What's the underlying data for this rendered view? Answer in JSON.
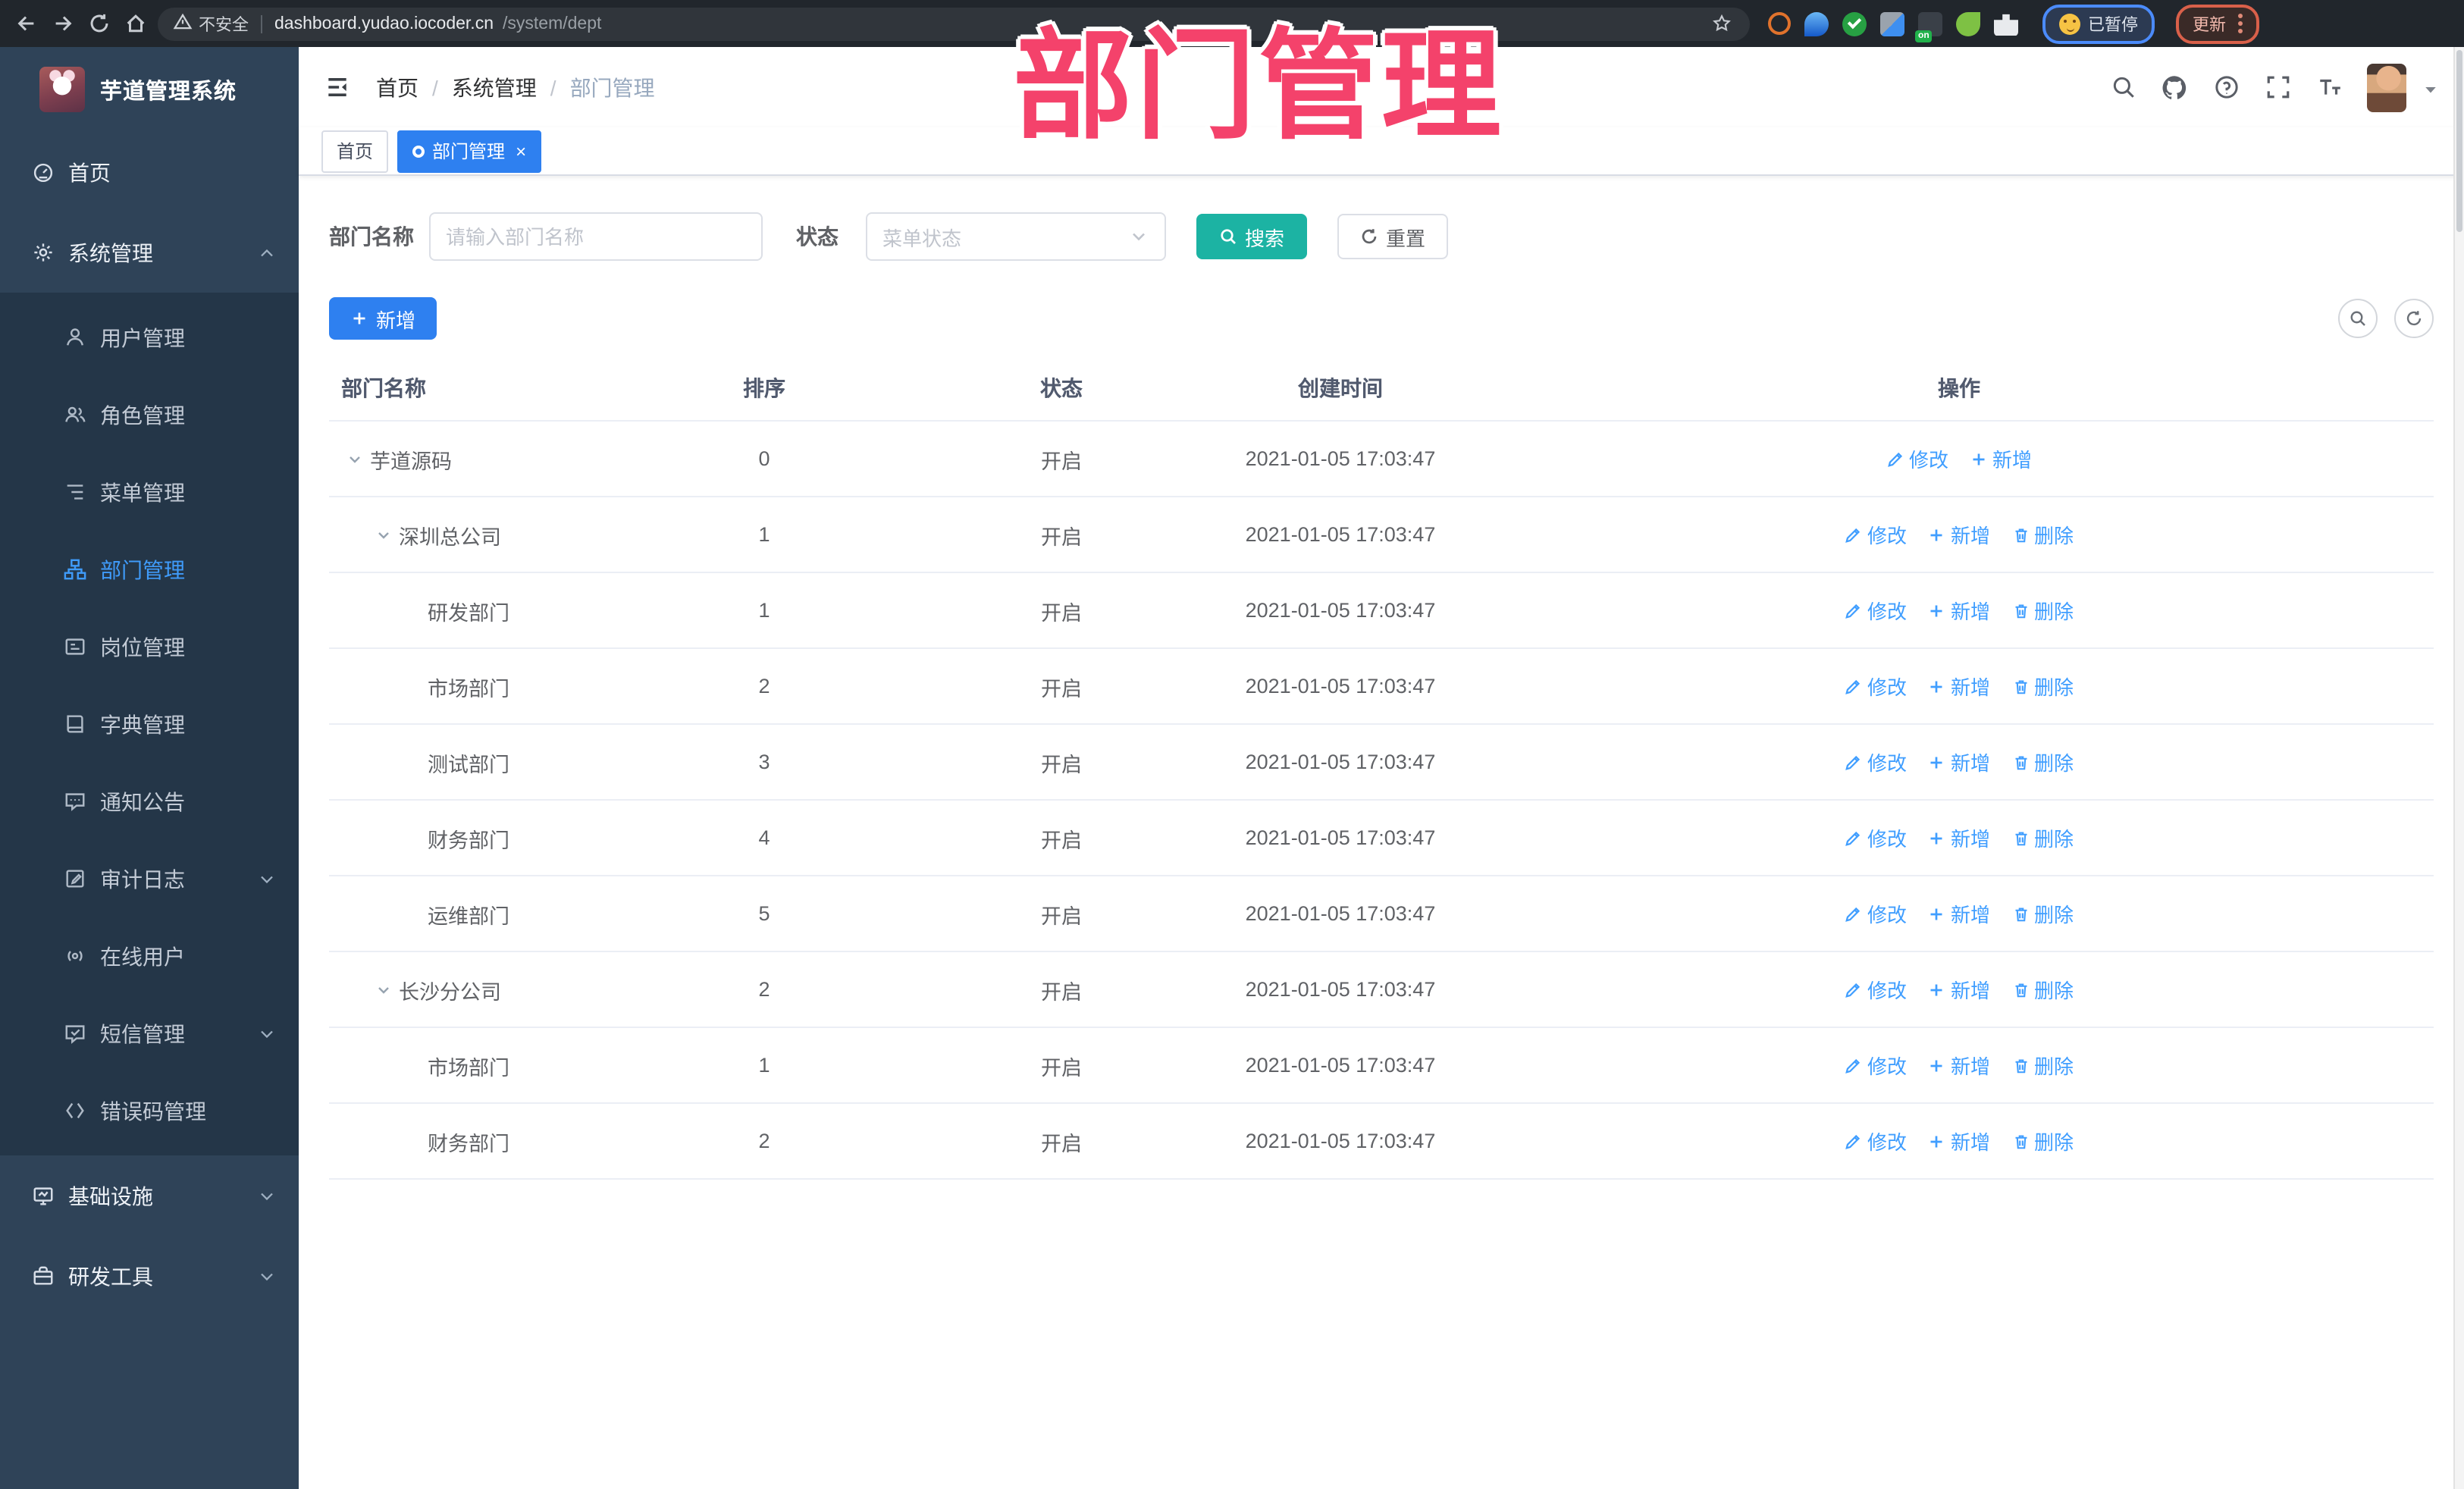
{
  "watermark": {
    "text": "部门管理",
    "color": "#f4426b"
  },
  "browser": {
    "security_label": "不安全",
    "url_host": "dashboard.yudao.iocoder.cn",
    "url_path": "/system/dept",
    "extension_badge": "on",
    "profile_label": "已暂停",
    "update_label": "更新",
    "nav_icons": [
      "back-icon",
      "forward-icon",
      "reload-icon",
      "home-icon"
    ],
    "extension_icons": [
      "target-icon",
      "pin-icon",
      "check-circle-icon",
      "grid-icon",
      "list-on-icon",
      "leaf-icon",
      "puzzle-icon"
    ]
  },
  "sidebar": {
    "logo_title": "芋道管理系统",
    "items": [
      {
        "label": "首页",
        "icon": "dashboard-icon"
      },
      {
        "label": "系统管理",
        "icon": "gear-icon",
        "chevron": "up",
        "children": [
          {
            "label": "用户管理",
            "icon": "user-icon"
          },
          {
            "label": "角色管理",
            "icon": "role-icon"
          },
          {
            "label": "菜单管理",
            "icon": "menu-list-icon"
          },
          {
            "label": "部门管理",
            "icon": "org-tree-icon",
            "active": true
          },
          {
            "label": "岗位管理",
            "icon": "post-card-icon"
          },
          {
            "label": "字典管理",
            "icon": "dict-book-icon"
          },
          {
            "label": "通知公告",
            "icon": "notice-icon"
          },
          {
            "label": "审计日志",
            "icon": "audit-log-icon",
            "chevron": "down"
          },
          {
            "label": "在线用户",
            "icon": "online-user-icon"
          },
          {
            "label": "短信管理",
            "icon": "sms-icon",
            "chevron": "down"
          },
          {
            "label": "错误码管理",
            "icon": "error-code-icon"
          }
        ]
      },
      {
        "label": "基础设施",
        "icon": "infra-monitor-icon",
        "chevron": "down"
      },
      {
        "label": "研发工具",
        "icon": "toolbox-icon",
        "chevron": "down"
      }
    ]
  },
  "header": {
    "breadcrumb": [
      "首页",
      "系统管理",
      "部门管理"
    ],
    "right_icons": [
      "search-icon",
      "github-icon",
      "help-icon",
      "fullscreen-icon",
      "font-size-icon",
      "user-avatar",
      "caret-down-icon"
    ]
  },
  "tabs": [
    {
      "label": "首页",
      "active": false,
      "closable": false
    },
    {
      "label": "部门管理",
      "active": true,
      "closable": true
    }
  ],
  "search": {
    "name_label": "部门名称",
    "name_placeholder": "请输入部门名称",
    "status_label": "状态",
    "status_placeholder": "菜单状态",
    "search_label": "搜索",
    "reset_label": "重置"
  },
  "toolbar": {
    "add_label": "新增"
  },
  "table": {
    "columns": [
      {
        "label": "部门名称"
      },
      {
        "label": "排序"
      },
      {
        "label": "状态"
      },
      {
        "label": "创建时间"
      },
      {
        "label": "操作"
      }
    ],
    "rows": [
      {
        "name": "芋道源码",
        "level": 0,
        "expandable": true,
        "order": "0",
        "status": "开启",
        "created": "2021-01-05 17:03:47",
        "actions": [
          {
            "label": "修改",
            "icon": "edit"
          },
          {
            "label": "新增",
            "icon": "plus"
          }
        ]
      },
      {
        "name": "深圳总公司",
        "level": 1,
        "expandable": true,
        "order": "1",
        "status": "开启",
        "created": "2021-01-05 17:03:47",
        "actions": [
          {
            "label": "修改",
            "icon": "edit"
          },
          {
            "label": "新增",
            "icon": "plus"
          },
          {
            "label": "删除",
            "icon": "trash"
          }
        ]
      },
      {
        "name": "研发部门",
        "level": 2,
        "expandable": false,
        "order": "1",
        "status": "开启",
        "created": "2021-01-05 17:03:47",
        "actions": [
          {
            "label": "修改",
            "icon": "edit"
          },
          {
            "label": "新增",
            "icon": "plus"
          },
          {
            "label": "删除",
            "icon": "trash"
          }
        ]
      },
      {
        "name": "市场部门",
        "level": 2,
        "expandable": false,
        "order": "2",
        "status": "开启",
        "created": "2021-01-05 17:03:47",
        "actions": [
          {
            "label": "修改",
            "icon": "edit"
          },
          {
            "label": "新增",
            "icon": "plus"
          },
          {
            "label": "删除",
            "icon": "trash"
          }
        ]
      },
      {
        "name": "测试部门",
        "level": 2,
        "expandable": false,
        "order": "3",
        "status": "开启",
        "created": "2021-01-05 17:03:47",
        "actions": [
          {
            "label": "修改",
            "icon": "edit"
          },
          {
            "label": "新增",
            "icon": "plus"
          },
          {
            "label": "删除",
            "icon": "trash"
          }
        ]
      },
      {
        "name": "财务部门",
        "level": 2,
        "expandable": false,
        "order": "4",
        "status": "开启",
        "created": "2021-01-05 17:03:47",
        "actions": [
          {
            "label": "修改",
            "icon": "edit"
          },
          {
            "label": "新增",
            "icon": "plus"
          },
          {
            "label": "删除",
            "icon": "trash"
          }
        ]
      },
      {
        "name": "运维部门",
        "level": 2,
        "expandable": false,
        "order": "5",
        "status": "开启",
        "created": "2021-01-05 17:03:47",
        "actions": [
          {
            "label": "修改",
            "icon": "edit"
          },
          {
            "label": "新增",
            "icon": "plus"
          },
          {
            "label": "删除",
            "icon": "trash"
          }
        ]
      },
      {
        "name": "长沙分公司",
        "level": 1,
        "expandable": true,
        "order": "2",
        "status": "开启",
        "created": "2021-01-05 17:03:47",
        "actions": [
          {
            "label": "修改",
            "icon": "edit"
          },
          {
            "label": "新增",
            "icon": "plus"
          },
          {
            "label": "删除",
            "icon": "trash"
          }
        ]
      },
      {
        "name": "市场部门",
        "level": 2,
        "expandable": false,
        "order": "1",
        "status": "开启",
        "created": "2021-01-05 17:03:47",
        "actions": [
          {
            "label": "修改",
            "icon": "edit"
          },
          {
            "label": "新增",
            "icon": "plus"
          },
          {
            "label": "删除",
            "icon": "trash"
          }
        ]
      },
      {
        "name": "财务部门",
        "level": 2,
        "expandable": false,
        "order": "2",
        "status": "开启",
        "created": "2021-01-05 17:03:47",
        "actions": [
          {
            "label": "修改",
            "icon": "edit"
          },
          {
            "label": "新增",
            "icon": "plus"
          },
          {
            "label": "删除",
            "icon": "trash"
          }
        ]
      }
    ]
  }
}
